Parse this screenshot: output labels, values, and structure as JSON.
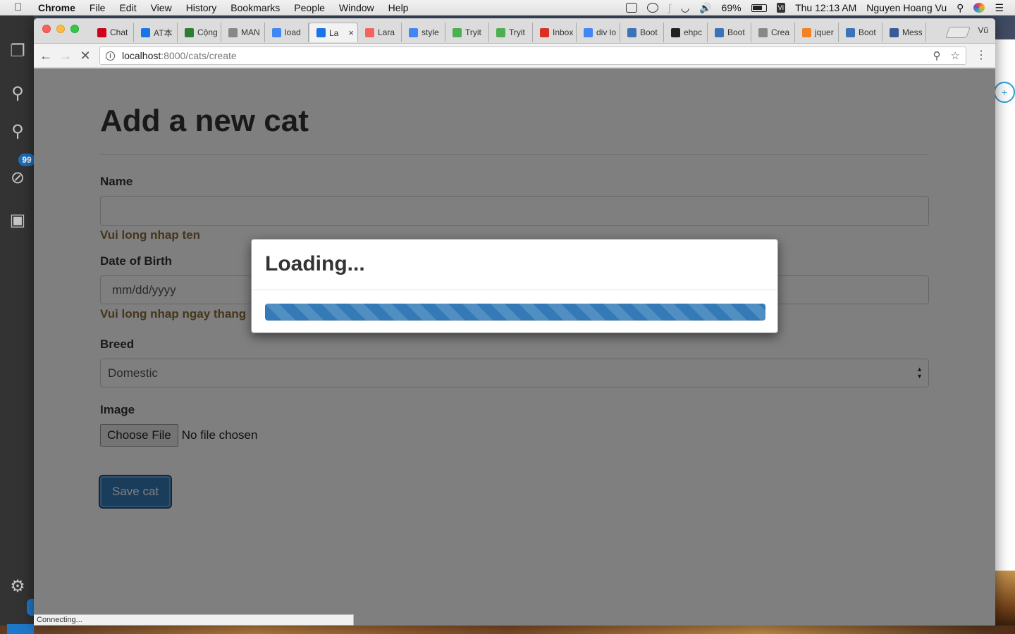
{
  "menubar": {
    "app": "Chrome",
    "items": [
      "File",
      "Edit",
      "View",
      "History",
      "Bookmarks",
      "People",
      "Window",
      "Help"
    ],
    "battery": "69%",
    "datetime": "Thu 12:13 AM",
    "user": "Nguyen Hoang Vu"
  },
  "vscode": {
    "badge": "99"
  },
  "browser": {
    "tabs": [
      {
        "label": "Chat",
        "icon": "red-chat-icon",
        "color": "#d0021b"
      },
      {
        "label": "AT本",
        "icon": "diamond-icon",
        "color": "#1a73e8"
      },
      {
        "label": "Cộng",
        "icon": "leaf-icon",
        "color": "#2e7d32"
      },
      {
        "label": "MAN",
        "icon": "page-icon",
        "color": "#888888"
      },
      {
        "label": "load",
        "icon": "google-icon",
        "color": "#4285f4"
      },
      {
        "label": "La",
        "icon": "loading-spinner-icon",
        "color": "#1a73e8",
        "active": true
      },
      {
        "label": "Lara",
        "icon": "laravel-icon",
        "color": "#f4645f"
      },
      {
        "label": "style",
        "icon": "google-icon",
        "color": "#4285f4"
      },
      {
        "label": "Tryit",
        "icon": "w3-icon",
        "color": "#4caf50"
      },
      {
        "label": "Tryit",
        "icon": "w3-icon",
        "color": "#4caf50"
      },
      {
        "label": "Inbox",
        "icon": "gmail-icon",
        "color": "#d93025"
      },
      {
        "label": "div lo",
        "icon": "google-icon",
        "color": "#4285f4"
      },
      {
        "label": "Boot",
        "icon": "bootsnipp-icon",
        "color": "#3b73b9"
      },
      {
        "label": "ehpc",
        "icon": "github-icon",
        "color": "#222222"
      },
      {
        "label": "Boot",
        "icon": "bootsnipp-icon",
        "color": "#3b73b9"
      },
      {
        "label": "Crea",
        "icon": "page-icon",
        "color": "#888888"
      },
      {
        "label": "jquer",
        "icon": "stackoverflow-icon",
        "color": "#f48024"
      },
      {
        "label": "Boot",
        "icon": "bootsnipp-icon",
        "color": "#3b73b9"
      },
      {
        "label": "Mess",
        "icon": "facebook-icon",
        "color": "#3b5998"
      }
    ],
    "profile": "Vũ",
    "url_host": "localhost",
    "url_path": ":8000/cats/create",
    "status": "Connecting..."
  },
  "form": {
    "title": "Add a new cat",
    "name_label": "Name",
    "name_value": "",
    "name_error": "Vui long nhap ten",
    "dob_label": "Date of Birth",
    "dob_placeholder": "mm/dd/yyyy",
    "dob_error": "Vui long nhap ngay thang",
    "breed_label": "Breed",
    "breed_value": "Domestic",
    "image_label": "Image",
    "file_button": "Choose File",
    "file_status": "No file chosen",
    "save_label": "Save cat"
  },
  "modal": {
    "title": "Loading...",
    "progress_percent": 100,
    "progress_color": "#337ab7"
  }
}
